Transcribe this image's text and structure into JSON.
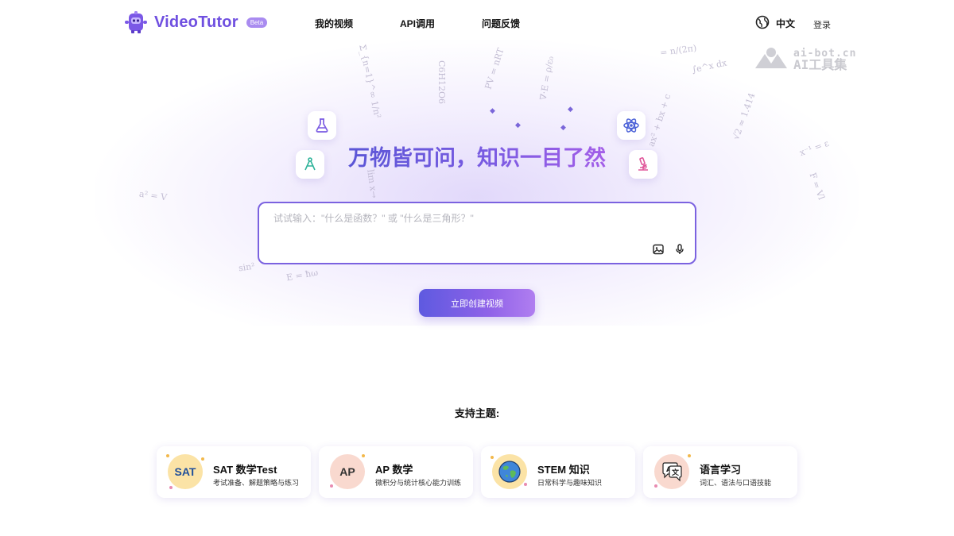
{
  "brand": {
    "name": "VideoTutor",
    "beta_label": "Beta",
    "accent_color": "#6f4fe0"
  },
  "nav": {
    "my_videos": "我的视频",
    "api": "API调用",
    "feedback": "问题反馈"
  },
  "header": {
    "language": "中文",
    "login": "登录",
    "language_icon": "globe-icon"
  },
  "watermark": {
    "line1": "ai-bot.cn",
    "line2": "AI工具集"
  },
  "background_formulas": [
    "Σ_{n=1}^∞ 1/n²",
    "C6H12O6",
    "PV = nRT",
    "∇·E = ρ/ε₀",
    "= n/(2π)",
    "∫e^x dx",
    "ax² + bx + c",
    "√2 ≈ 1.414",
    "x⁻¹ = ε",
    "F = Vl",
    "a² = V",
    "sin²",
    "E = ħω",
    "lim x→"
  ],
  "hero": {
    "title": "万物皆可问，知识一目了然"
  },
  "search": {
    "placeholder": "试试输入：\"什么是函数？\" 或 \"什么是三角形？\"",
    "value": "",
    "image_icon": "image-icon",
    "mic_icon": "microphone-icon"
  },
  "cta": {
    "label": "立即创建视频"
  },
  "topics": {
    "title": "支持主题:",
    "items": [
      {
        "badge": "SAT",
        "title": "SAT 数学Test",
        "subtitle": "考试准备、解题策略与练习",
        "badge_bg": "#fbe3a6",
        "badge_color": "#1f4f9a"
      },
      {
        "badge": "AP",
        "title": "AP 数学",
        "subtitle": "微积分与统计核心能力训练",
        "badge_bg": "#f9d9cf",
        "badge_color": "#333333"
      },
      {
        "badge": "",
        "title": "STEM 知识",
        "subtitle": "日常科学与趣味知识",
        "badge_bg": "#fbe3a6",
        "badge_color": "#333333"
      },
      {
        "badge": "",
        "title": "语言学习",
        "subtitle": "词汇、语法与口语技能",
        "badge_bg": "#f9d9cf",
        "badge_color": "#333333"
      }
    ]
  }
}
